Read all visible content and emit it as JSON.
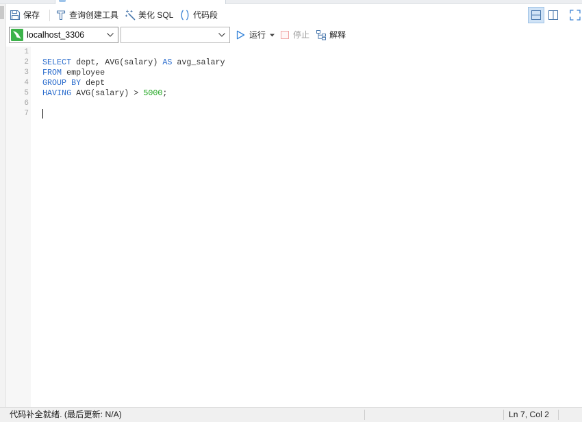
{
  "toolbar": {
    "save": {
      "label": "保存",
      "icon": "save-icon"
    },
    "query_builder": {
      "label": "查询创建工具",
      "icon": "query-builder-icon"
    },
    "beautify": {
      "label": "美化 SQL",
      "icon": "magic-wand-icon"
    },
    "snippet": {
      "label": "代码段",
      "icon": "code-snippet-icon"
    },
    "view_modes": [
      {
        "icon": "split-horizontal-icon",
        "selected": true
      },
      {
        "icon": "split-vertical-icon",
        "selected": false
      }
    ],
    "fullscreen": {
      "icon": "fullscreen-icon"
    }
  },
  "query_bar": {
    "connection": {
      "value": "localhost_3306",
      "icon": "mysql-connection-icon"
    },
    "database": {
      "value": ""
    },
    "run": {
      "label": "运行",
      "icon": "play-icon"
    },
    "stop": {
      "label": "停止",
      "icon": "stop-icon",
      "enabled": false
    },
    "explain": {
      "label": "解释",
      "icon": "explain-icon"
    }
  },
  "editor": {
    "lines": [
      {
        "number": "1",
        "tokens": []
      },
      {
        "number": "2",
        "tokens": [
          {
            "text": "SELECT",
            "color": "#2a6ccd"
          },
          {
            "text": " dept, AVG(salary) ",
            "color": "#333333"
          },
          {
            "text": "AS",
            "color": "#2a6ccd"
          },
          {
            "text": " avg_salary",
            "color": "#333333"
          }
        ]
      },
      {
        "number": "3",
        "tokens": [
          {
            "text": "FROM",
            "color": "#2a6ccd"
          },
          {
            "text": " employee",
            "color": "#333333"
          }
        ]
      },
      {
        "number": "4",
        "tokens": [
          {
            "text": "GROUP BY",
            "color": "#2a6ccd"
          },
          {
            "text": " dept",
            "color": "#333333"
          }
        ]
      },
      {
        "number": "5",
        "tokens": [
          {
            "text": "HAVING",
            "color": "#2a6ccd"
          },
          {
            "text": " AVG(salary) > ",
            "color": "#333333"
          },
          {
            "text": "5000",
            "color": "#19a319"
          },
          {
            "text": ";",
            "color": "#333333"
          }
        ]
      },
      {
        "number": "6",
        "tokens": []
      },
      {
        "number": "7",
        "tokens": []
      }
    ]
  },
  "status_bar": {
    "message": "代码补全就绪. (最后更新: N/A)",
    "cursor_position": "Ln 7, Col 2"
  },
  "colors": {
    "icon": "#4b79ad",
    "accent": "#3b82d4",
    "run": "#2f80d8",
    "stop": "#f0a3a3",
    "selected_bg": "#d0e3f6",
    "connection": "#3cb34a",
    "disabled_text": "#9b9b9b"
  }
}
